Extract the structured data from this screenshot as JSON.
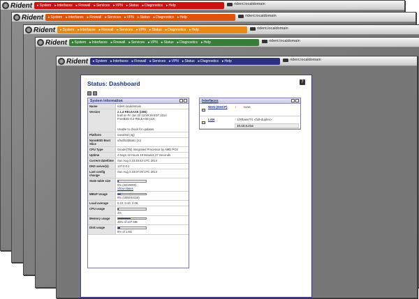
{
  "app": {
    "logo": "Rident",
    "hostname": "rident.localdomain"
  },
  "menu": [
    "System",
    "Interfaces",
    "Firewall",
    "Services",
    "VPN",
    "Status",
    "Diagnostics",
    "Help"
  ],
  "colors": {
    "win1": "#cc1111",
    "win2": "#e0520c",
    "win3": "#e68a1a",
    "win4": "#3a7d3a",
    "win5": "#2c2e82"
  },
  "page": {
    "title": "Status: Dashboard",
    "help_icon": "?"
  },
  "sysinfo": {
    "title": "System Information",
    "name_label": "Name",
    "name": "rident.localdomain",
    "version_label": "Version",
    "version_line1": "2.1.4-RELEASE (i386)",
    "version_line2": "built on Fri Jun 20 12:59:29 EDT 2014",
    "version_line3": "FreeBSD 8.3-RELEASE-p16",
    "version_line4": "Unable to check for updates.",
    "platform_label": "Platform",
    "platform": "nanobsd (4g)",
    "boot_label": "NanoBSD Boot Slice",
    "boot": "ufsid/53d0a51 (ro)",
    "cpu_label": "CPU Type",
    "cpu": "Geode(TM) Integrated Processor by AMD PCS",
    "uptime_label": "Uptime",
    "uptime": "4 Days 19 Hours 19 Minutes 27 Seconds",
    "date_label": "Current date/time",
    "date": "Sun Aug 3 23:46:53 UTC 2014",
    "dns_label": "DNS server(s)",
    "dns": "127.0.0.1",
    "lastchange_label": "Last config change",
    "lastchange": "Sun Aug 3 23:07:09 UTC 2014",
    "state_label": "State table size",
    "state": "0% (32/20000)",
    "state_link": "Show states",
    "state_pct": 0.01,
    "mbuf_label": "MBUF Usage",
    "mbuf": "9% (1892/44116)",
    "mbuf_pct": 0.09,
    "load_label": "Load average",
    "load": "0.10, 0.10, 0.09",
    "cpuu_label": "CPU usage",
    "cpuu": "2%",
    "cpuu_pct": 0.02,
    "mem_label": "Memory usage",
    "mem": "45% of 107 MB",
    "mem_pct": 0.45,
    "disk_label": "Disk usage",
    "disk": "8% of 1.9G",
    "disk_pct": 0.08
  },
  "interfaces": {
    "title": "Interfaces",
    "wan_name": "WAN (DHCP)",
    "wan_status": "none",
    "lan_name": "LAN",
    "lan_status": "100baseTX <full-duplex>",
    "lan_addr": "10.10.0.214"
  }
}
